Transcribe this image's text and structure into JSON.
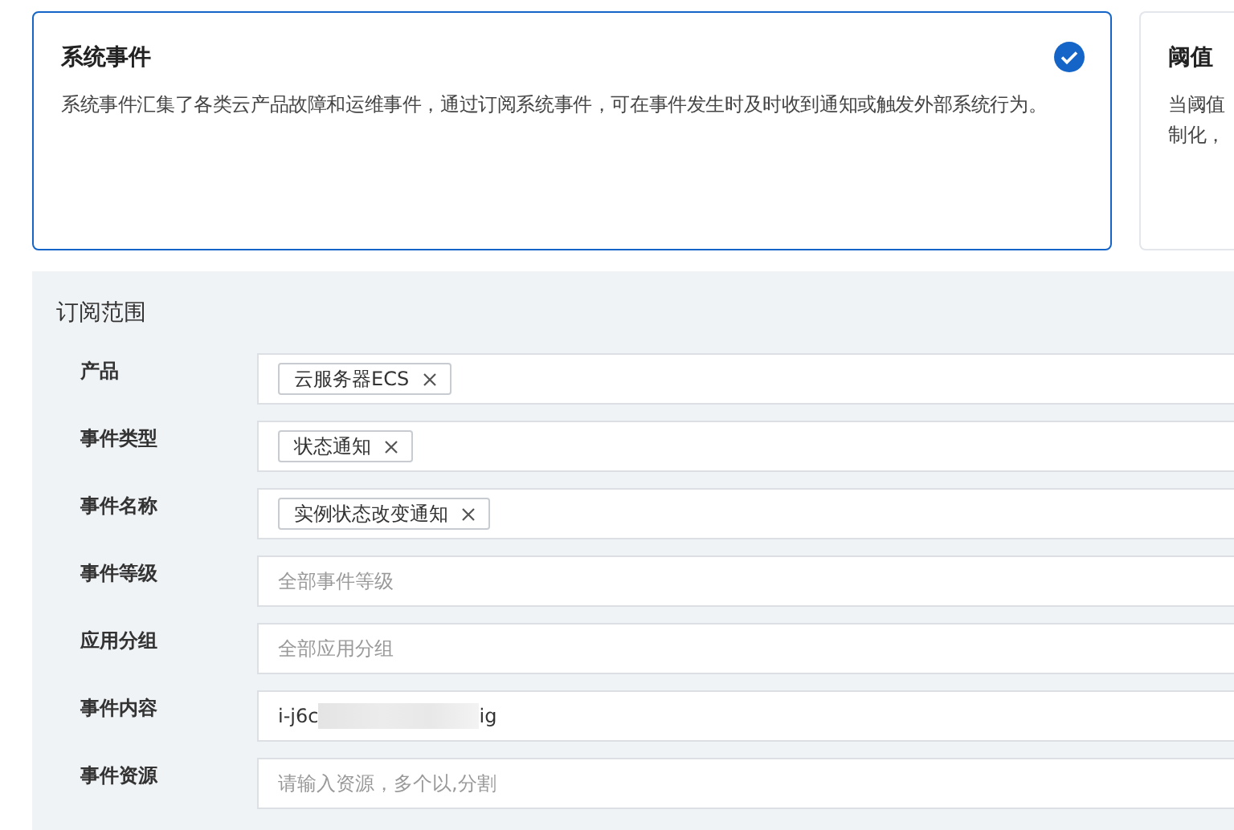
{
  "cards": [
    {
      "title": "系统事件",
      "description_lines": [
        "系统事件汇集了各类云产品故障和运维事件，通过订阅系统事件，可在事件发生时及时收到通知或触发外部系统行为。"
      ],
      "selected": true
    },
    {
      "title": "阈值",
      "description_lines": [
        "当阈值",
        "制化，"
      ],
      "selected": false
    }
  ],
  "subscription_scope": {
    "title": "订阅范围",
    "fields": [
      {
        "label": "产品",
        "kind": "tags",
        "tags": [
          "云服务器ECS"
        ]
      },
      {
        "label": "事件类型",
        "kind": "tags",
        "tags": [
          "状态通知"
        ]
      },
      {
        "label": "事件名称",
        "kind": "tags",
        "tags": [
          "实例状态改变通知"
        ]
      },
      {
        "label": "事件等级",
        "kind": "input",
        "placeholder": "全部事件等级"
      },
      {
        "label": "应用分组",
        "kind": "input",
        "placeholder": "全部应用分组"
      },
      {
        "label": "事件内容",
        "kind": "redacted",
        "value_start": "i-j6c",
        "value_end": "ig"
      },
      {
        "label": "事件资源",
        "kind": "input",
        "placeholder": "请输入资源，多个以,分割"
      }
    ]
  }
}
